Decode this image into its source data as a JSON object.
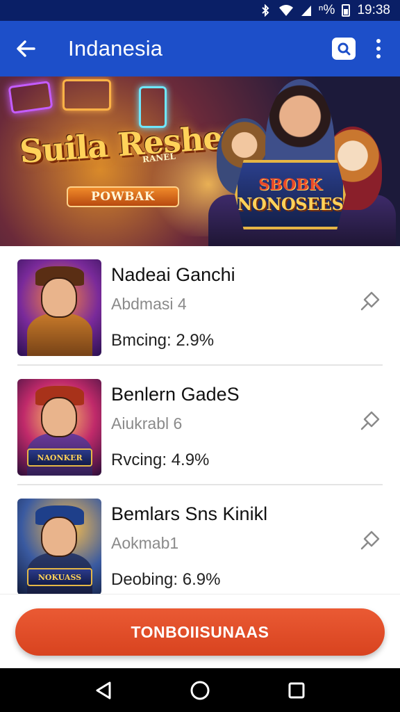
{
  "status_bar": {
    "signal_text": "ⁿ%",
    "time": "19:38",
    "icons": [
      "bluetooth-icon",
      "wifi-icon",
      "cell-signal-icon",
      "battery-icon"
    ]
  },
  "app_bar": {
    "title": "Indanesia",
    "back_icon": "arrow-left-icon",
    "search_icon": "search-icon",
    "menu_icon": "more-vert-icon",
    "color": "#1d4fc9"
  },
  "banner": {
    "logo_text": "Suila Reshey",
    "logo_subtext": "RANEL",
    "pill_label": "POWBAK",
    "badge_top": "SBOBK",
    "badge_main": "NONOSEES"
  },
  "games": [
    {
      "name": "Nadeai Ganchi",
      "subtitle": "Abdmasi 4",
      "rating": "Bmcing: 2.9%",
      "thumb_label": "",
      "pin_icon": "pin-icon"
    },
    {
      "name": "Benlern GadeS",
      "subtitle": "Aiukrabl 6",
      "rating": "Rvcing: 4.9%",
      "thumb_label": "NAONKER",
      "pin_icon": "pin-icon"
    },
    {
      "name": "Bemlars Sns Kinikl",
      "subtitle": "Aokmab1",
      "rating": "Deobing: 6.9%",
      "thumb_label": "NOKUASS",
      "pin_icon": "pin-icon"
    }
  ],
  "cta": {
    "label": "TONBOIISUNAAS",
    "color": "#e24d28"
  },
  "nav_bar": {
    "back": "nav-back-icon",
    "home": "nav-home-icon",
    "recents": "nav-recents-icon"
  }
}
